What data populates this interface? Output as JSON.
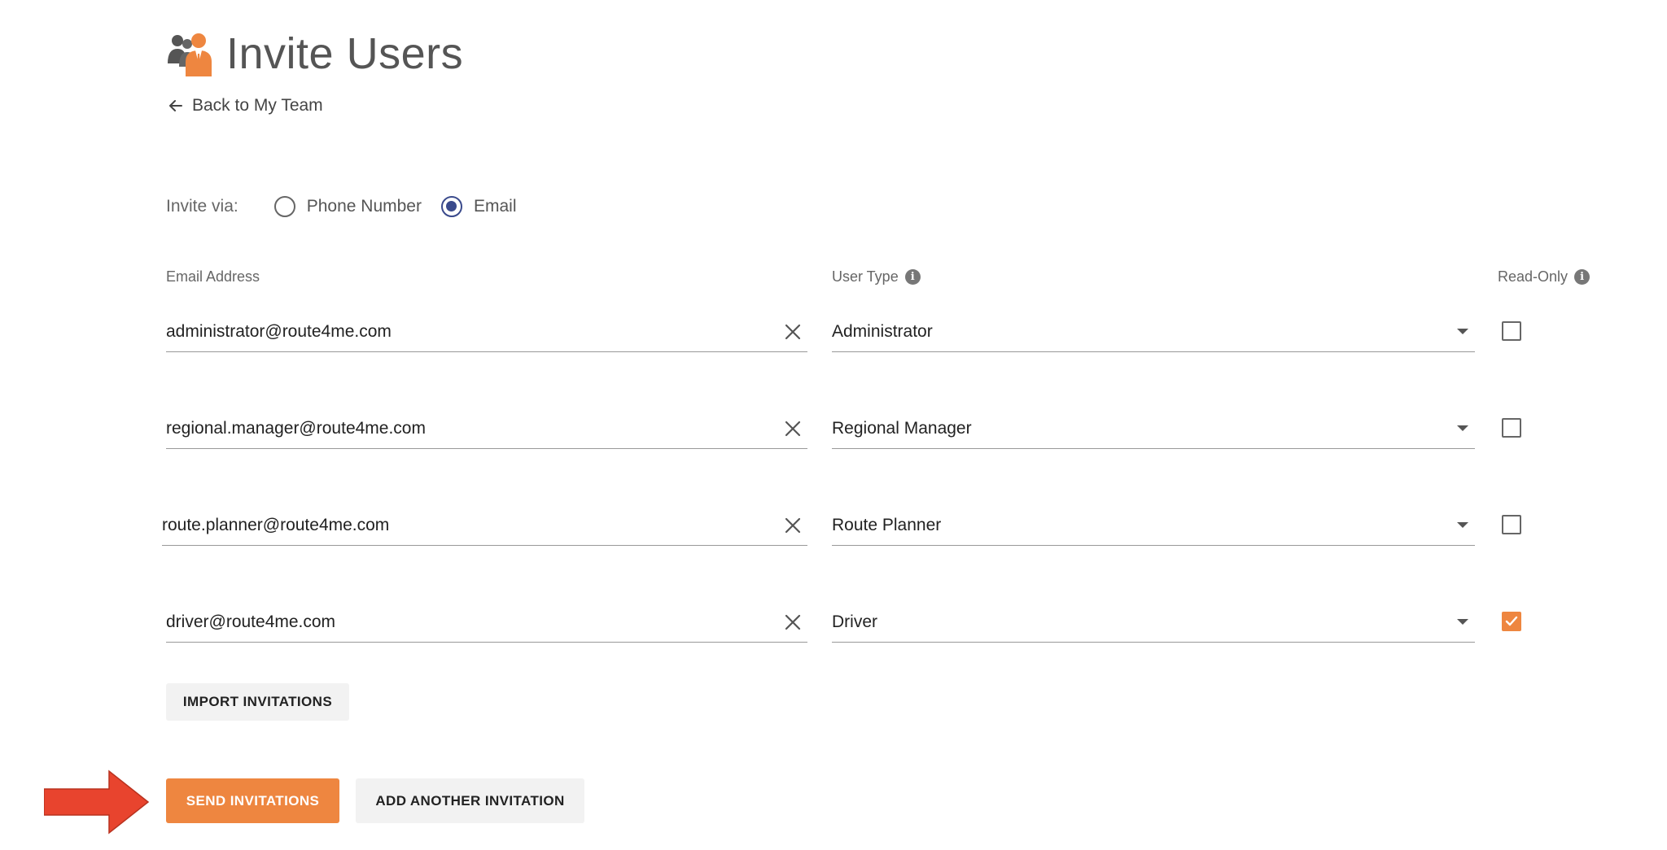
{
  "header": {
    "title": "Invite Users",
    "icon": "users-icon",
    "back_label": "Back to My Team"
  },
  "invite_via": {
    "label": "Invite via:",
    "options": [
      {
        "label": "Phone Number",
        "selected": false
      },
      {
        "label": "Email",
        "selected": true
      }
    ]
  },
  "columns": {
    "email": "Email Address",
    "user_type": "User Type",
    "read_only": "Read-Only"
  },
  "rows": [
    {
      "email": "administrator@route4me.com",
      "user_type": "Administrator",
      "read_only": false
    },
    {
      "email": "regional.manager@route4me.com",
      "user_type": "Regional Manager",
      "read_only": false
    },
    {
      "email": "route.planner@route4me.com",
      "user_type": "Route Planner",
      "read_only": false
    },
    {
      "email": "driver@route4me.com",
      "user_type": "Driver",
      "read_only": true
    }
  ],
  "buttons": {
    "import": "IMPORT INVITATIONS",
    "send": "SEND INVITATIONS",
    "add": "ADD ANOTHER INVITATION"
  },
  "colors": {
    "accent": "#ee8640",
    "radio_selected": "#3a4a8c",
    "annotation_arrow": "#e8442e"
  }
}
